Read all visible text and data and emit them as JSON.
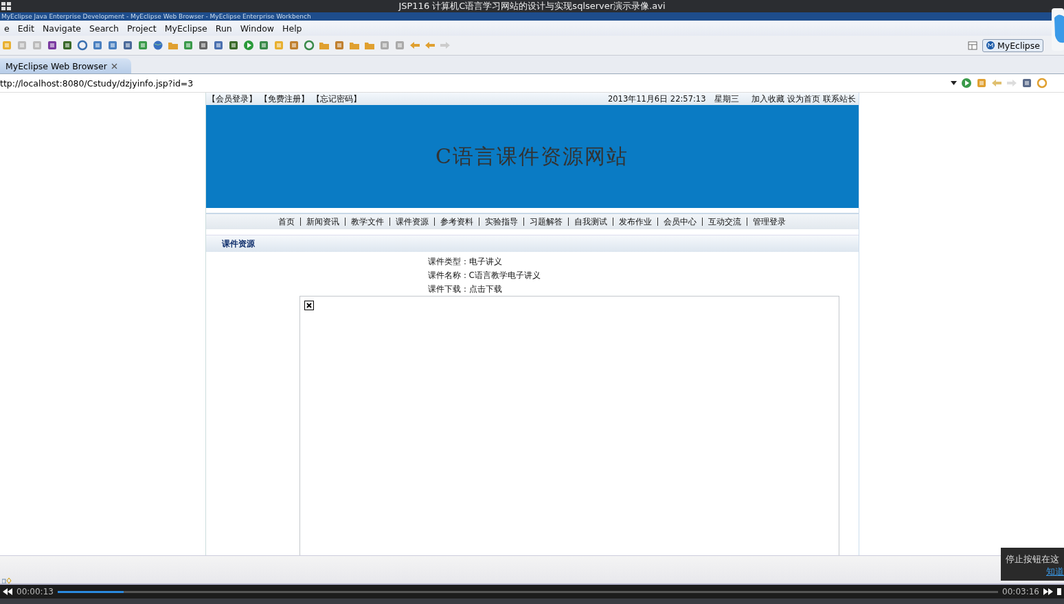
{
  "player": {
    "title": "JSP116 计算机C语言学习网站的设计与实现sqlserver演示录像.avi",
    "elapsed": "00:00:13",
    "total": "00:03:16",
    "level": 0.07,
    "tooltip": {
      "text": "停止按钮在这",
      "link": "知道"
    }
  },
  "window": {
    "title": "MyEclipse Java Enterprise Development - MyEclipse Web Browser - MyEclipse Enterprise Workbench",
    "menu": [
      "e",
      "Edit",
      "Navigate",
      "Search",
      "Project",
      "MyEclipse",
      "Run",
      "Window",
      "Help"
    ],
    "perspective": "MyEclipse"
  },
  "tabs": [
    {
      "label": "MyEclipse Web Browser",
      "selected": true
    }
  ],
  "browser": {
    "url": "ttp://localhost:8080/Cstudy/dzjyinfo.jsp?id=3"
  },
  "page": {
    "top_links": [
      "【会员登录】",
      "【免费注册】",
      "【忘记密码】"
    ],
    "datetime": "2013年11月6日 22:57:13",
    "weekday": "星期三",
    "shortcuts": [
      "加入收藏",
      "设为首页",
      "联系站长"
    ],
    "site_title": "C语言课件资源网站",
    "nav": [
      "首页",
      "新闻资讯",
      "教学文件",
      "课件资源",
      "参考资料",
      "实验指导",
      "习题解答",
      "自我测试",
      "发布作业",
      "会员中心",
      "互动交流",
      "管理登录"
    ],
    "section_title": "课件资源",
    "details": [
      "课件类型：电子讲义",
      "课件名称：C语言教学电子讲义",
      "课件下载：点击下载"
    ]
  }
}
